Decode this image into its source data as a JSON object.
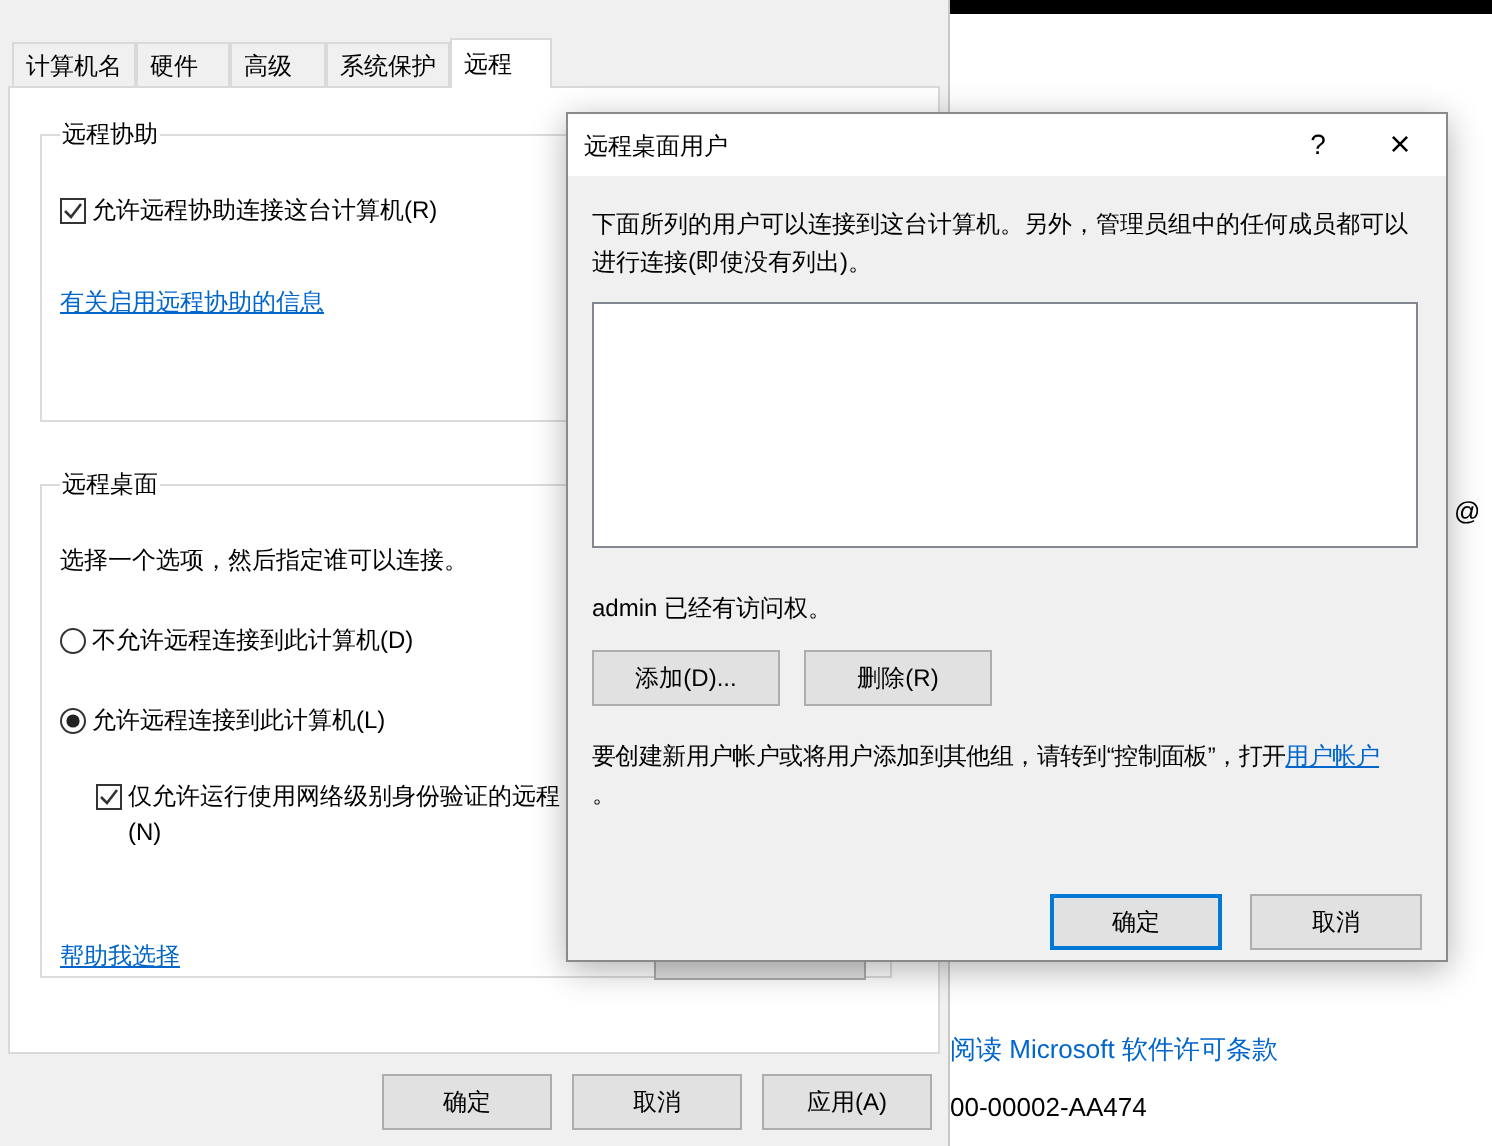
{
  "system_properties": {
    "tabs": [
      {
        "label": "计算机名",
        "selected": false
      },
      {
        "label": "硬件",
        "selected": false
      },
      {
        "label": "高级",
        "selected": false
      },
      {
        "label": "系统保护",
        "selected": false
      },
      {
        "label": "远程",
        "selected": true
      }
    ],
    "remote_assistance": {
      "title": "远程协助",
      "checkbox": {
        "label": "允许远程协助连接这台计算机(R)",
        "checked": true
      },
      "link": "有关启用远程协助的信息"
    },
    "remote_desktop": {
      "title": "远程桌面",
      "instruction": "选择一个选项，然后指定谁可以连接。",
      "options": [
        {
          "label": "不允许远程连接到此计算机(D)",
          "selected": false
        },
        {
          "label": "允许远程连接到此计算机(L)",
          "selected": true
        }
      ],
      "nla_checkbox": {
        "label_lines": [
          "仅允许运行使用网络级别身份验证的远程",
          "(N)"
        ],
        "checked": true
      },
      "help_link": "帮助我选择"
    },
    "buttons": [
      "确定",
      "取消",
      "应用(A)"
    ]
  },
  "background_window": {
    "text_1": "@",
    "link": "阅读 Microsoft 软件许可条款",
    "text_2": "00-00002-AA474"
  },
  "dialog": {
    "title": "远程桌面用户",
    "help": "?",
    "close": "×",
    "description": "下面所列的用户可以连接到这台计算机。另外，管理员组中的任何成员都可以进行连接(即使没有列出)。",
    "access_note": "admin 已经有访问权。",
    "list_buttons": [
      "添加(D)...",
      "删除(R)"
    ],
    "info": "要创建新用户帐户或将用户添加到其他组，请转到“控制面板”，打开",
    "info_link": "用户帐户",
    "info_end": "。",
    "buttons": [
      {
        "label": "确定",
        "default": true
      },
      {
        "label": "取消",
        "default": false
      }
    ]
  }
}
